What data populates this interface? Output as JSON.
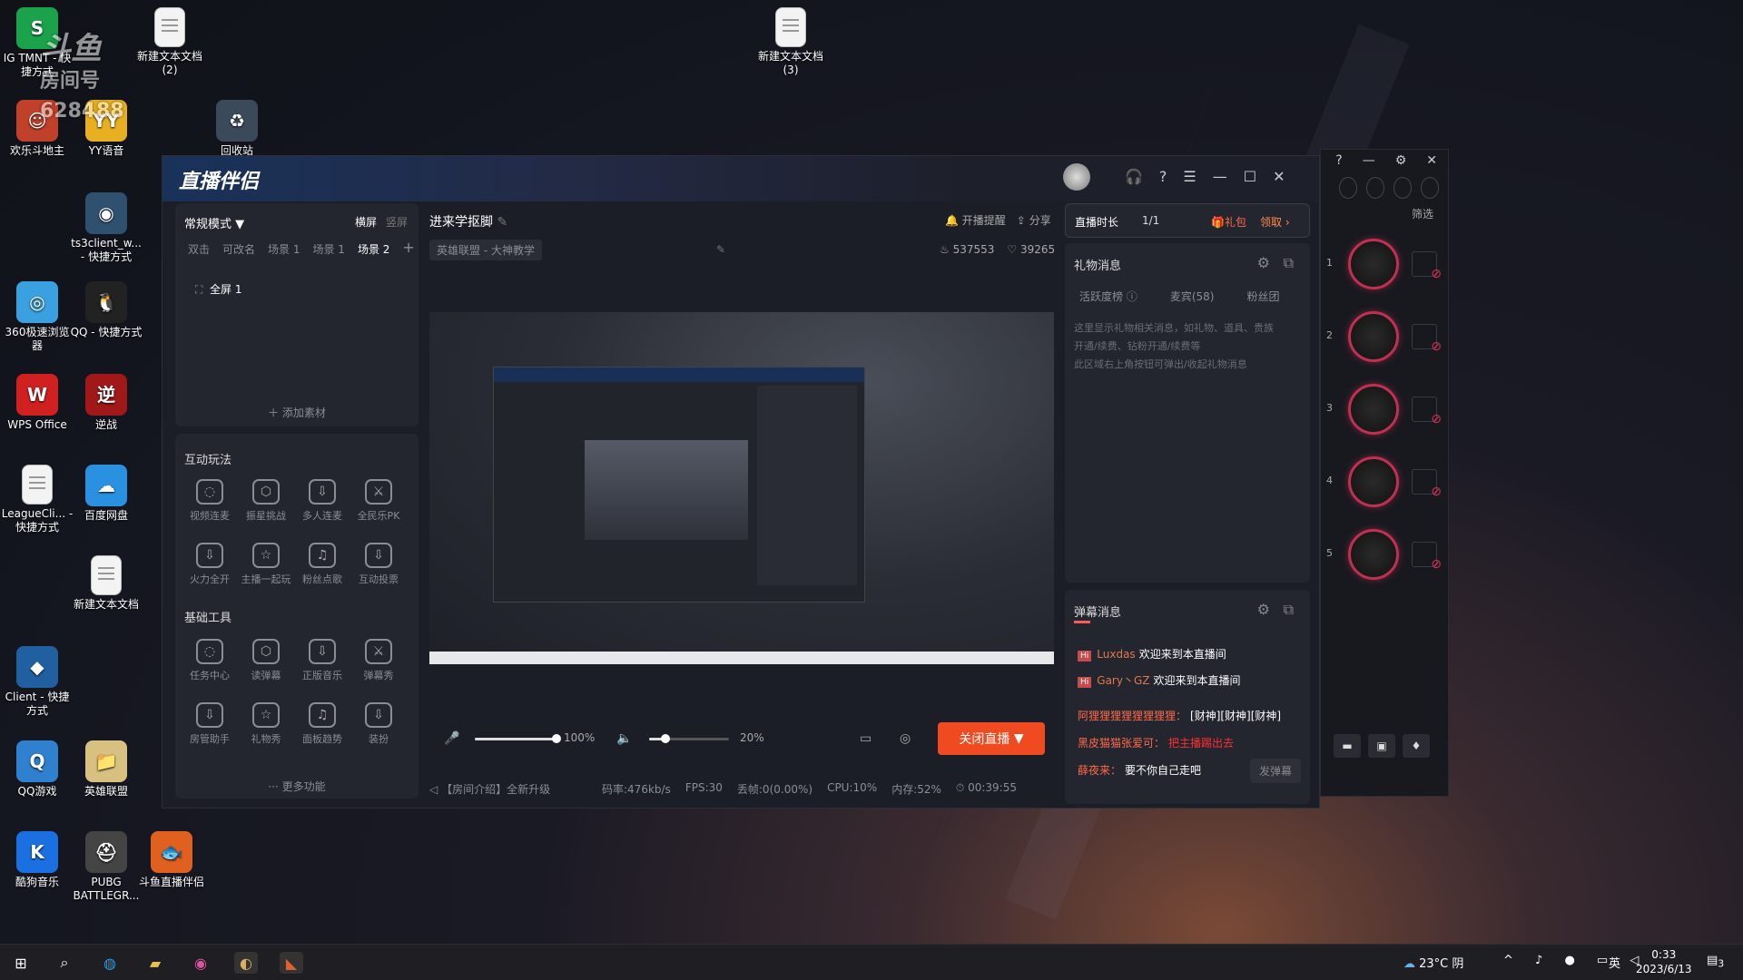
{
  "desktop_icons": [
    {
      "label": "IG TMNT - 快捷方式",
      "color": "#1aa34a",
      "glyph": "S"
    },
    {
      "label": "新建文本文档 (2)",
      "color": "doc",
      "glyph": ""
    },
    {
      "label": "新建文本文档 (3)",
      "color": "doc",
      "glyph": ""
    },
    {
      "label": "回收站",
      "color": "#3a4a5a",
      "glyph": "♻"
    },
    {
      "label": "欢乐斗地主",
      "color": "#c0402a",
      "glyph": "☺"
    },
    {
      "label": "YY语音",
      "color": "#e8b020",
      "glyph": "YY"
    },
    {
      "label": "ts3client_w... - 快捷方式",
      "color": "#305070",
      "glyph": "◉"
    },
    {
      "label": "360极速浏览器",
      "color": "#3aa0e0",
      "glyph": "◎"
    },
    {
      "label": "QQ - 快捷方式",
      "color": "#222",
      "glyph": "🐧"
    },
    {
      "label": "WPS Office",
      "color": "#d02020",
      "glyph": "W"
    },
    {
      "label": "逆战",
      "color": "#a01818",
      "glyph": "逆"
    },
    {
      "label": "LeagueCli... - 快捷方式",
      "color": "doc",
      "glyph": ""
    },
    {
      "label": "百度网盘",
      "color": "#2a90e0",
      "glyph": "☁"
    },
    {
      "label": "新建文本文档",
      "color": "doc",
      "glyph": ""
    },
    {
      "label": "Client - 快捷方式",
      "color": "#2060a0",
      "glyph": "◆"
    },
    {
      "label": "QQ游戏",
      "color": "#3080d0",
      "glyph": "Q"
    },
    {
      "label": "英雄联盟",
      "color": "#d8c080",
      "glyph": "📁"
    },
    {
      "label": "酷狗音乐",
      "color": "#1a70e0",
      "glyph": "K"
    },
    {
      "label": "PUBG BATTLEGR...",
      "color": "#444",
      "glyph": "⛑"
    },
    {
      "label": "斗鱼直播伴侣",
      "color": "#e06020",
      "glyph": "🐟"
    }
  ],
  "watermark": {
    "line1": "斗鱼",
    "line2": "房间号",
    "line3": "6284",
    "line4": "88"
  },
  "window": {
    "logo": "直播伴侣",
    "mode_label": "常规模式",
    "orientation": [
      "横屏",
      "竖屏"
    ],
    "scenes": [
      "双击",
      "可改名",
      "场景 1",
      "场景 1",
      "场景 2"
    ],
    "add_scene": "+",
    "source_item": "全屏 1",
    "add_material": "添加素材",
    "interactive_title": "互动玩法",
    "interactive_tools": [
      "视频连麦",
      "振星挑战",
      "多人连麦",
      "全民乐PK",
      "火力全开",
      "主播一起玩",
      "粉丝点歌",
      "互动投票"
    ],
    "basic_title": "基础工具",
    "basic_tools": [
      "任务中心",
      "读弹幕",
      "正版音乐",
      "弹幕秀",
      "房管助手",
      "礼物秀",
      "面板趋势",
      "装扮"
    ],
    "more": "更多功能",
    "stream_title": "进来学抠脚",
    "category": "英雄联盟 - 大神教学",
    "notify": "开播提醒",
    "share": "分享",
    "hot": "537553",
    "likes": "39265",
    "live_duration_label": "直播时长",
    "live_progress": "1/1",
    "gift_pack": "礼包",
    "claim": "领取",
    "gift_title": "礼物消息",
    "gift_tabs": [
      "活跃度榜",
      "麦宾(58)",
      "粉丝团"
    ],
    "gift_desc": [
      "这里显示礼物相关消息，如礼物、道具、贵族",
      "开通/续费、钻粉开通/续费等",
      "此区域右上角按钮可弹出/收起礼物消息"
    ],
    "danmaku_title": "弹幕消息",
    "chat": [
      {
        "user": "Luxdas",
        "msg": "欢迎来到本直播间"
      },
      {
        "user": "Gary丶GZ",
        "msg": "欢迎来到本直播间"
      },
      {
        "user": "阿狸狸狸狸狸狸狸狸：",
        "msg": "[财神][财神][财神]"
      },
      {
        "user": "黑皮猫猫张爱可：",
        "msg": "把主播踢出去"
      },
      {
        "user": "薛夜来：",
        "msg": "要不你自己走吧"
      }
    ],
    "send_danmaku": "发弹幕",
    "mic_volume": "100%",
    "mic_level": 1.0,
    "speaker_volume": "20%",
    "speaker_level": 0.2,
    "stop_live": "关闭直播",
    "room_intro": "【房间介绍】全新升级",
    "status": [
      "码率:476kb/s",
      "FPS:30",
      "丢帧:0(0.00%)",
      "CPU:10%",
      "内存:52%",
      "00:39:55"
    ],
    "side_filter": "筛选",
    "knob_numbers": [
      "1",
      "2",
      "3",
      "4",
      "5"
    ]
  },
  "taskbar": {
    "weather": "23°C 阴",
    "ime": "英",
    "time": "0:33",
    "date": "2023/6/13",
    "notif": "3"
  }
}
